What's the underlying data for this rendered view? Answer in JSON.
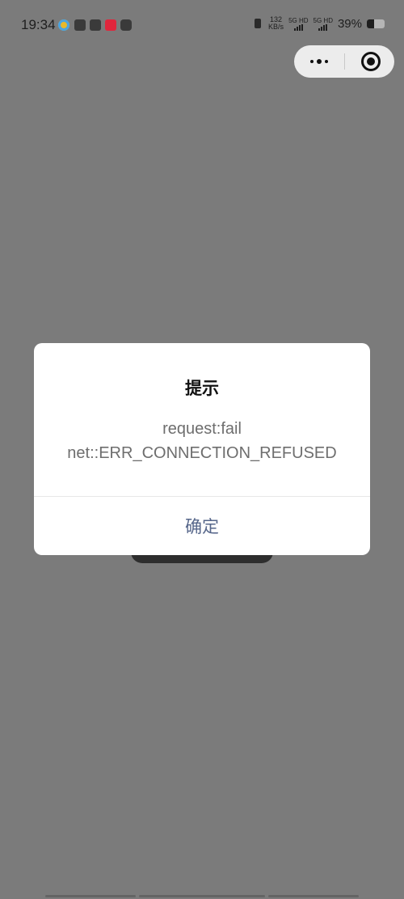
{
  "status_bar": {
    "time": "19:34",
    "net_speed_value": "132",
    "net_speed_unit": "KB/s",
    "sim1_label": "5G HD",
    "sim2_label": "5G HD",
    "battery_text": "39%",
    "battery_level": 0.39
  },
  "dialog": {
    "title": "提示",
    "message_line1": "request:fail",
    "message_line2": "net::ERR_CONNECTION_REFUSED",
    "confirm_label": "确定"
  },
  "icons": {
    "capsule_more": "more-dots-icon",
    "capsule_close": "close-target-icon",
    "vibrate": "vibrate-icon",
    "battery": "battery-icon"
  },
  "colors": {
    "overlay": "#7b7b7b",
    "dialog_bg": "#ffffff",
    "confirm_text": "#56668a",
    "message_text": "#6e6e6e"
  }
}
